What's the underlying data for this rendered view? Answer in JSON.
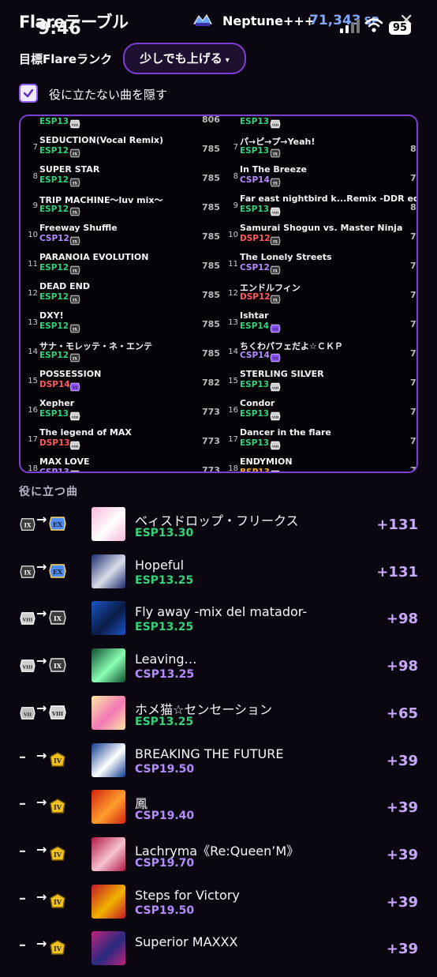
{
  "header": {
    "title": "Flareテーブル",
    "time": "9:46",
    "player_name": "Neptune+++",
    "sp_value": "71,343",
    "sp_unit": "SP",
    "battery": "95",
    "close_glyph": "✕"
  },
  "target": {
    "label": "目標Flareランク",
    "selected": "少しでも上げる",
    "caret": "▾"
  },
  "hide_option": {
    "label": "役に立たない曲を隠す",
    "checked": true
  },
  "table": {
    "left": [
      {
        "rank": "",
        "name": "",
        "diff": "ESP13",
        "diff_class": "esp",
        "badge": "VIII",
        "score": "806"
      },
      {
        "rank": "7",
        "name": "SEDUCTION(Vocal Remix)",
        "diff": "ESP12",
        "diff_class": "esp",
        "badge": "IX",
        "score": "785"
      },
      {
        "rank": "8",
        "name": "SUPER STAR",
        "diff": "ESP12",
        "diff_class": "esp",
        "badge": "IX",
        "score": "785"
      },
      {
        "rank": "9",
        "name": "TRIP MACHINE～luv mix～",
        "diff": "ESP12",
        "diff_class": "esp",
        "badge": "IX",
        "score": "785"
      },
      {
        "rank": "10",
        "name": "Freeway Shuffle",
        "diff": "CSP12",
        "diff_class": "csp",
        "badge": "IX",
        "score": "785"
      },
      {
        "rank": "11",
        "name": "PARANOIA EVOLUTION",
        "diff": "ESP12",
        "diff_class": "esp",
        "badge": "IX",
        "score": "785"
      },
      {
        "rank": "12",
        "name": "DEAD END",
        "diff": "ESP12",
        "diff_class": "esp",
        "badge": "IX",
        "score": "785"
      },
      {
        "rank": "13",
        "name": "DXY!",
        "diff": "ESP12",
        "diff_class": "esp",
        "badge": "IX",
        "score": "785"
      },
      {
        "rank": "14",
        "name": "サナ・モレッテ・ネ・エンテ",
        "diff": "ESP12",
        "diff_class": "esp",
        "badge": "IX",
        "score": "785"
      },
      {
        "rank": "15",
        "name": "POSSESSION",
        "diff": "DSP14",
        "diff_class": "dsp",
        "badge": "VI",
        "score": "782"
      },
      {
        "rank": "16",
        "name": "Xepher",
        "diff": "ESP13",
        "diff_class": "esp",
        "badge": "VIII",
        "score": "773"
      },
      {
        "rank": "17",
        "name": "The legend of MAX",
        "diff": "DSP13",
        "diff_class": "dsp",
        "badge": "VIII",
        "score": "773"
      },
      {
        "rank": "18",
        "name": "MAX LOVE",
        "diff": "CSP13",
        "diff_class": "csp",
        "badge": "VIII",
        "score": "773"
      }
    ],
    "right": [
      {
        "rank": "",
        "name": "",
        "diff": "ESP13",
        "diff_class": "esp",
        "badge": "VIII",
        "score": ""
      },
      {
        "rank": "7",
        "name": "パ→ピ→プ→Yeah!",
        "diff": "ESP13",
        "diff_class": "esp",
        "badge": "IX",
        "score": "8"
      },
      {
        "rank": "8",
        "name": "In The Breeze",
        "diff": "CSP14",
        "diff_class": "csp",
        "badge": "IX",
        "score": "7"
      },
      {
        "rank": "9",
        "name": "Far east nightbird k...Remix -DDR edit ve",
        "diff": "ESP13",
        "diff_class": "esp",
        "badge": "VIII",
        "score": "8"
      },
      {
        "rank": "10",
        "name": "Samurai Shogun vs. Master Ninja",
        "diff": "DSP12",
        "diff_class": "dsp",
        "badge": "IX",
        "score": "7"
      },
      {
        "rank": "11",
        "name": "The Lonely Streets",
        "diff": "CSP12",
        "diff_class": "csp",
        "badge": "IX",
        "score": "7"
      },
      {
        "rank": "12",
        "name": "エンドルフィン",
        "diff": "DSP12",
        "diff_class": "dsp",
        "badge": "IX",
        "score": "7"
      },
      {
        "rank": "13",
        "name": "Ishtar",
        "diff": "ESP14",
        "diff_class": "esp",
        "badge": "VI",
        "score": "7"
      },
      {
        "rank": "14",
        "name": "ちくわパフェだよ☆ＣＫＰ",
        "diff": "CSP14",
        "diff_class": "csp",
        "badge": "VI",
        "score": "7"
      },
      {
        "rank": "15",
        "name": "STERLING SILVER",
        "diff": "ESP13",
        "diff_class": "esp",
        "badge": "VIII",
        "score": "7"
      },
      {
        "rank": "16",
        "name": "Condor",
        "diff": "ESP13",
        "diff_class": "esp",
        "badge": "VIII",
        "score": "7"
      },
      {
        "rank": "17",
        "name": "Dancer in the flare",
        "diff": "ESP13",
        "diff_class": "esp",
        "badge": "VIII",
        "score": "7"
      },
      {
        "rank": "18",
        "name": "ENDYMION",
        "diff": "BSP13",
        "diff_class": "bsp",
        "badge": "VIII",
        "score": "7"
      }
    ]
  },
  "useful": {
    "title": "役に立つ曲",
    "songs": [
      {
        "from": "IX",
        "to": "EX",
        "title": "ベィスドロップ・フリークス",
        "level": "ESP13.30",
        "level_class": "esp",
        "gain": "+131",
        "jacket": [
          "#f7b7d8",
          "#ffffff"
        ]
      },
      {
        "from": "IX",
        "to": "EX",
        "title": "Hopeful",
        "level": "ESP13.25",
        "level_class": "esp",
        "gain": "+131",
        "jacket": [
          "#1a2a6e",
          "#d9dde8"
        ]
      },
      {
        "from": "VIII",
        "to": "IX",
        "title": "Fly away -mix del matador-",
        "level": "ESP13.25",
        "level_class": "esp",
        "gain": "+98",
        "jacket": [
          "#1a56c8",
          "#0a1b44"
        ]
      },
      {
        "from": "VIII",
        "to": "IX",
        "title": "Leaving…",
        "level": "CSP13.25",
        "level_class": "csp",
        "gain": "+98",
        "jacket": [
          "#0e4d2e",
          "#89ffb2"
        ]
      },
      {
        "from": "VII",
        "to": "VIII",
        "title": "ホメ猫☆センセーション",
        "level": "ESP13.25",
        "level_class": "esp",
        "gain": "+65",
        "jacket": [
          "#fbe5a3",
          "#f37ab5"
        ]
      },
      {
        "from": "–",
        "to": "IV",
        "title": "BREAKING THE FUTURE",
        "level": "CSP19.50",
        "level_class": "csp",
        "gain": "+39",
        "jacket": [
          "#0e3b8f",
          "#ffffff"
        ]
      },
      {
        "from": "–",
        "to": "IV",
        "title": "鳳",
        "level": "CSP19.40",
        "level_class": "csp",
        "gain": "+39",
        "jacket": [
          "#d2230e",
          "#ff9d2b"
        ]
      },
      {
        "from": "–",
        "to": "IV",
        "title": "Lachryma《Re:Queen’M》",
        "level": "CSP19.70",
        "level_class": "csp",
        "gain": "+39",
        "jacket": [
          "#b11846",
          "#f6c2cf"
        ]
      },
      {
        "from": "–",
        "to": "IV",
        "title": "Steps for Victory",
        "level": "CSP19.50",
        "level_class": "csp",
        "gain": "+39",
        "jacket": [
          "#c3162b",
          "#f1b400"
        ]
      },
      {
        "from": "–",
        "to": "IV",
        "title": "Superior MAXXX",
        "level": "",
        "level_class": "csp",
        "gain": "+39",
        "jacket": [
          "#c0237a",
          "#262a80"
        ]
      }
    ]
  }
}
